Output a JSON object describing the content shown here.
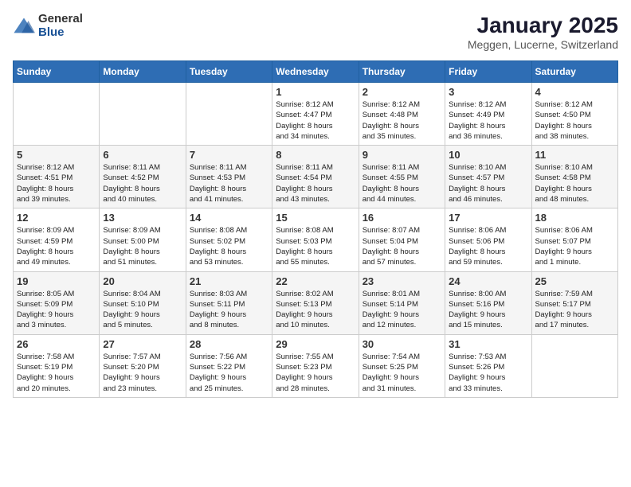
{
  "header": {
    "logo_general": "General",
    "logo_blue": "Blue",
    "title": "January 2025",
    "subtitle": "Meggen, Lucerne, Switzerland"
  },
  "weekdays": [
    "Sunday",
    "Monday",
    "Tuesday",
    "Wednesday",
    "Thursday",
    "Friday",
    "Saturday"
  ],
  "weeks": [
    [
      {
        "day": "",
        "info": ""
      },
      {
        "day": "",
        "info": ""
      },
      {
        "day": "",
        "info": ""
      },
      {
        "day": "1",
        "info": "Sunrise: 8:12 AM\nSunset: 4:47 PM\nDaylight: 8 hours\nand 34 minutes."
      },
      {
        "day": "2",
        "info": "Sunrise: 8:12 AM\nSunset: 4:48 PM\nDaylight: 8 hours\nand 35 minutes."
      },
      {
        "day": "3",
        "info": "Sunrise: 8:12 AM\nSunset: 4:49 PM\nDaylight: 8 hours\nand 36 minutes."
      },
      {
        "day": "4",
        "info": "Sunrise: 8:12 AM\nSunset: 4:50 PM\nDaylight: 8 hours\nand 38 minutes."
      }
    ],
    [
      {
        "day": "5",
        "info": "Sunrise: 8:12 AM\nSunset: 4:51 PM\nDaylight: 8 hours\nand 39 minutes."
      },
      {
        "day": "6",
        "info": "Sunrise: 8:11 AM\nSunset: 4:52 PM\nDaylight: 8 hours\nand 40 minutes."
      },
      {
        "day": "7",
        "info": "Sunrise: 8:11 AM\nSunset: 4:53 PM\nDaylight: 8 hours\nand 41 minutes."
      },
      {
        "day": "8",
        "info": "Sunrise: 8:11 AM\nSunset: 4:54 PM\nDaylight: 8 hours\nand 43 minutes."
      },
      {
        "day": "9",
        "info": "Sunrise: 8:11 AM\nSunset: 4:55 PM\nDaylight: 8 hours\nand 44 minutes."
      },
      {
        "day": "10",
        "info": "Sunrise: 8:10 AM\nSunset: 4:57 PM\nDaylight: 8 hours\nand 46 minutes."
      },
      {
        "day": "11",
        "info": "Sunrise: 8:10 AM\nSunset: 4:58 PM\nDaylight: 8 hours\nand 48 minutes."
      }
    ],
    [
      {
        "day": "12",
        "info": "Sunrise: 8:09 AM\nSunset: 4:59 PM\nDaylight: 8 hours\nand 49 minutes."
      },
      {
        "day": "13",
        "info": "Sunrise: 8:09 AM\nSunset: 5:00 PM\nDaylight: 8 hours\nand 51 minutes."
      },
      {
        "day": "14",
        "info": "Sunrise: 8:08 AM\nSunset: 5:02 PM\nDaylight: 8 hours\nand 53 minutes."
      },
      {
        "day": "15",
        "info": "Sunrise: 8:08 AM\nSunset: 5:03 PM\nDaylight: 8 hours\nand 55 minutes."
      },
      {
        "day": "16",
        "info": "Sunrise: 8:07 AM\nSunset: 5:04 PM\nDaylight: 8 hours\nand 57 minutes."
      },
      {
        "day": "17",
        "info": "Sunrise: 8:06 AM\nSunset: 5:06 PM\nDaylight: 8 hours\nand 59 minutes."
      },
      {
        "day": "18",
        "info": "Sunrise: 8:06 AM\nSunset: 5:07 PM\nDaylight: 9 hours\nand 1 minute."
      }
    ],
    [
      {
        "day": "19",
        "info": "Sunrise: 8:05 AM\nSunset: 5:09 PM\nDaylight: 9 hours\nand 3 minutes."
      },
      {
        "day": "20",
        "info": "Sunrise: 8:04 AM\nSunset: 5:10 PM\nDaylight: 9 hours\nand 5 minutes."
      },
      {
        "day": "21",
        "info": "Sunrise: 8:03 AM\nSunset: 5:11 PM\nDaylight: 9 hours\nand 8 minutes."
      },
      {
        "day": "22",
        "info": "Sunrise: 8:02 AM\nSunset: 5:13 PM\nDaylight: 9 hours\nand 10 minutes."
      },
      {
        "day": "23",
        "info": "Sunrise: 8:01 AM\nSunset: 5:14 PM\nDaylight: 9 hours\nand 12 minutes."
      },
      {
        "day": "24",
        "info": "Sunrise: 8:00 AM\nSunset: 5:16 PM\nDaylight: 9 hours\nand 15 minutes."
      },
      {
        "day": "25",
        "info": "Sunrise: 7:59 AM\nSunset: 5:17 PM\nDaylight: 9 hours\nand 17 minutes."
      }
    ],
    [
      {
        "day": "26",
        "info": "Sunrise: 7:58 AM\nSunset: 5:19 PM\nDaylight: 9 hours\nand 20 minutes."
      },
      {
        "day": "27",
        "info": "Sunrise: 7:57 AM\nSunset: 5:20 PM\nDaylight: 9 hours\nand 23 minutes."
      },
      {
        "day": "28",
        "info": "Sunrise: 7:56 AM\nSunset: 5:22 PM\nDaylight: 9 hours\nand 25 minutes."
      },
      {
        "day": "29",
        "info": "Sunrise: 7:55 AM\nSunset: 5:23 PM\nDaylight: 9 hours\nand 28 minutes."
      },
      {
        "day": "30",
        "info": "Sunrise: 7:54 AM\nSunset: 5:25 PM\nDaylight: 9 hours\nand 31 minutes."
      },
      {
        "day": "31",
        "info": "Sunrise: 7:53 AM\nSunset: 5:26 PM\nDaylight: 9 hours\nand 33 minutes."
      },
      {
        "day": "",
        "info": ""
      }
    ]
  ]
}
